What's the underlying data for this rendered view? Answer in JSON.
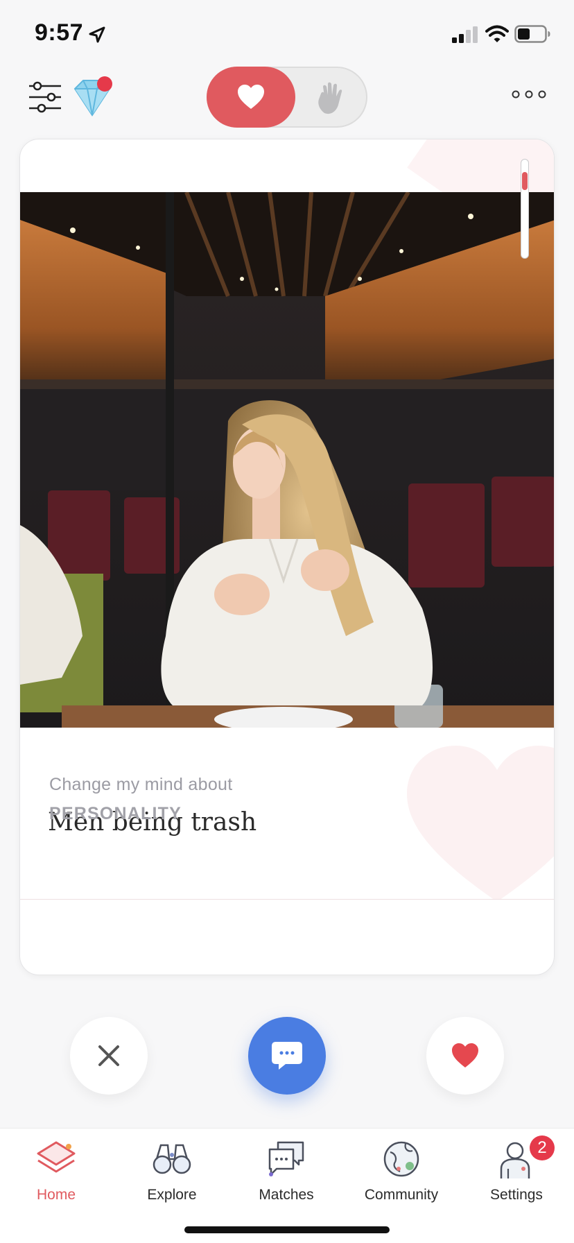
{
  "status_bar": {
    "time": "9:57",
    "icons": [
      "location-arrow-icon",
      "cellular-signal-icon",
      "wifi-icon",
      "battery-icon"
    ]
  },
  "top_bar": {
    "filter_icon": "sliders-icon",
    "premium_icon": "diamond-icon",
    "mode_toggle": {
      "options": [
        "heart-icon",
        "wave-hand-icon"
      ],
      "selected": "heart-icon"
    },
    "more_icon": "ellipsis-icon"
  },
  "card": {
    "photo_alt": "Photo",
    "prompt": {
      "label": "Change my mind about",
      "answer": "Men being trash"
    },
    "next_section_label": "PERSONALITY",
    "scroll_position": 0.12
  },
  "actions": {
    "pass_icon": "close-icon",
    "message_icon": "chat-bubble-icon",
    "like_icon": "heart-icon"
  },
  "tab_bar": {
    "items": [
      {
        "label": "Home",
        "icon": "layers-icon",
        "active": true
      },
      {
        "label": "Explore",
        "icon": "binoculars-icon",
        "active": false
      },
      {
        "label": "Matches",
        "icon": "chat-bubbles-icon",
        "active": false
      },
      {
        "label": "Community",
        "icon": "globe-icon",
        "active": false
      },
      {
        "label": "Settings",
        "icon": "person-icon",
        "active": false,
        "badge": "2"
      }
    ]
  },
  "colors": {
    "accent": "#e05a5f",
    "message_blue": "#4a7de2",
    "badge_red": "#e5394a"
  }
}
